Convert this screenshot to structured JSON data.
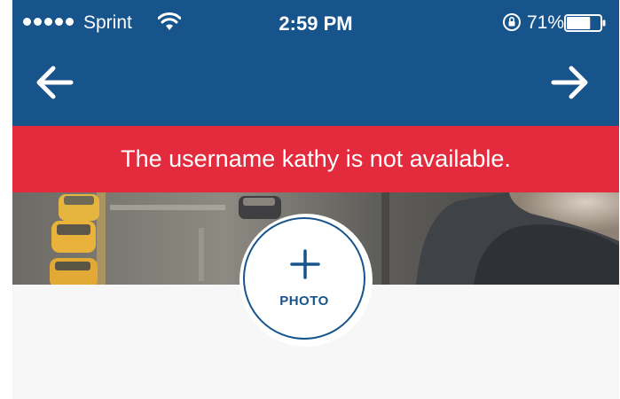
{
  "status_bar": {
    "carrier": "Sprint",
    "time": "2:59 PM",
    "battery_percent": "71%",
    "battery_level": 0.71,
    "signal_dots": 5,
    "icons": [
      "signal-dots-icon",
      "wifi-icon",
      "orientation-lock-icon",
      "battery-icon"
    ]
  },
  "nav": {
    "back_icon": "arrow-left-icon",
    "forward_icon": "arrow-right-icon"
  },
  "error_banner": {
    "message": "The username kathy is not available."
  },
  "photo_button": {
    "icon": "plus-icon",
    "label": "PHOTO"
  },
  "colors": {
    "header_blue": "#17548c",
    "error_red": "#e42a3d",
    "background": "#f7f7f7",
    "white": "#ffffff"
  }
}
